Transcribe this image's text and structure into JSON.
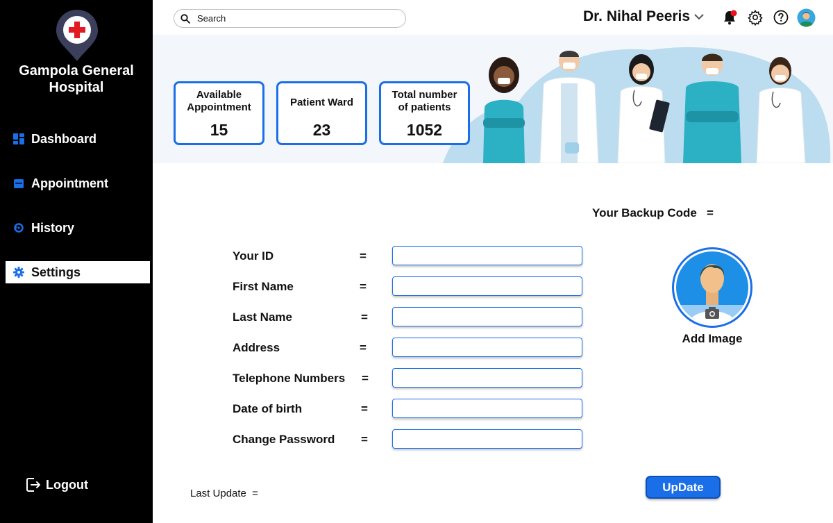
{
  "sidebar": {
    "hospital_name_line1": "Gampola General",
    "hospital_name_line2": "Hospital",
    "items": [
      {
        "label": "Dashboard",
        "icon": "dashboard-grid-icon"
      },
      {
        "label": "Appointment",
        "icon": "calendar-icon"
      },
      {
        "label": "History",
        "icon": "history-icon"
      },
      {
        "label": "Settings",
        "icon": "gear-icon",
        "active": true
      }
    ],
    "logout_label": "Logout"
  },
  "header": {
    "search_placeholder": "Search",
    "user_name": "Dr. Nihal Peeris",
    "icons": [
      "notification-bell-icon",
      "settings-gear-icon",
      "help-icon",
      "user-avatar-icon"
    ]
  },
  "stats": [
    {
      "label_line1": "Available",
      "label_line2": "Appointment",
      "value": "15"
    },
    {
      "label_line1": "Patient Ward",
      "label_line2": "",
      "value": "23"
    },
    {
      "label_line1": "Total number",
      "label_line2": "of patients",
      "value": "1052"
    }
  ],
  "form": {
    "backup_code_label": "Your Backup Code",
    "equals": "=",
    "fields": [
      {
        "label": "Your ID",
        "value": ""
      },
      {
        "label": "First Name",
        "value": ""
      },
      {
        "label": "Last Name",
        "value": ""
      },
      {
        "label": "Address",
        "value": ""
      },
      {
        "label": "Telephone Numbers",
        "value": ""
      },
      {
        "label": "Date of birth",
        "value": ""
      },
      {
        "label": "Change Password",
        "value": ""
      }
    ],
    "add_image_label": "Add Image",
    "last_update_label": "Last Update",
    "update_button_label": "UpDate"
  },
  "colors": {
    "accent": "#1a6ee8",
    "sidebar_bg": "#000000",
    "banner_bg": "#f3f6fb",
    "notification_dot": "#e8141c"
  }
}
